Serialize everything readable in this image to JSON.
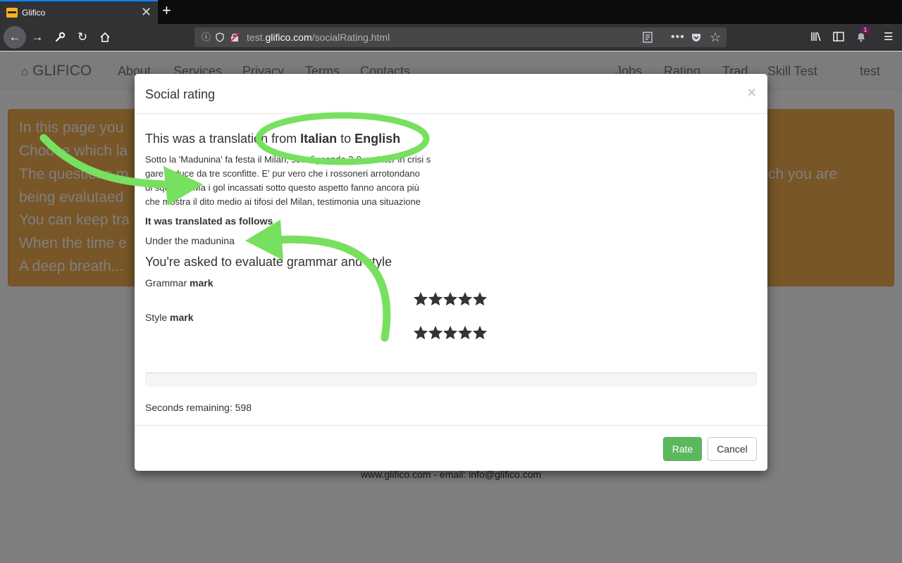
{
  "browser": {
    "tab_title": "Glifico",
    "tab_close": "✕",
    "new_tab": "+",
    "url_prefix": "test.",
    "url_domain": "glifico.com",
    "url_path": "/socialRating.html",
    "notification_count": "1"
  },
  "site": {
    "brand": "GLIFICO",
    "nav_left": [
      "About",
      "Services",
      "Privacy",
      "Terms",
      "Contacts"
    ],
    "nav_right": [
      "Jobs",
      "Rating",
      "Trad",
      "Skill Test"
    ],
    "user": "test",
    "alert_lines": [
      "In this page you",
      "Choose which la",
      "The questions m",
      "being evalutaed",
      "You can keep tra",
      "When the time e",
      "A deep breath..."
    ],
    "alert_right_fragment": "ch you are",
    "footer": "www.glifico.com - email: info@glifico.com"
  },
  "modal": {
    "title": "Social rating",
    "close": "×",
    "translation_prefix": "This was a translation from ",
    "source_language": "Italian",
    "translation_mid": " to ",
    "target_language": "English",
    "source_lines": [
      "Sotto la 'Madunina' fa festa il Milan, sconfiggendo 3-0 un Inter in crisi s",
      "gare reduce da tre sconfitte. E' pur vero che i rossoneri arrotondano",
      "di squadra. Ma i gol incassati sotto questo aspetto fanno ancora più",
      "che mostra il dito medio ai tifosi del Milan, testimonia una situazione"
    ],
    "translated_label": "It was translated as follows",
    "translated_text": "Under the madunina",
    "evaluate_heading": "You're asked to evaluate grammar and style",
    "grammar_label": "Grammar",
    "style_label": "Style",
    "mark_word": "mark",
    "grammar_stars": 5,
    "style_stars": 5,
    "progress_fraction": 0,
    "seconds_remaining": "Seconds remaining: 598",
    "rate_label": "Rate",
    "cancel_label": "Cancel"
  },
  "colors": {
    "accent_green": "#5cb85c",
    "annotation_green": "#77e05f",
    "alert_orange": "#f0ad4e"
  }
}
